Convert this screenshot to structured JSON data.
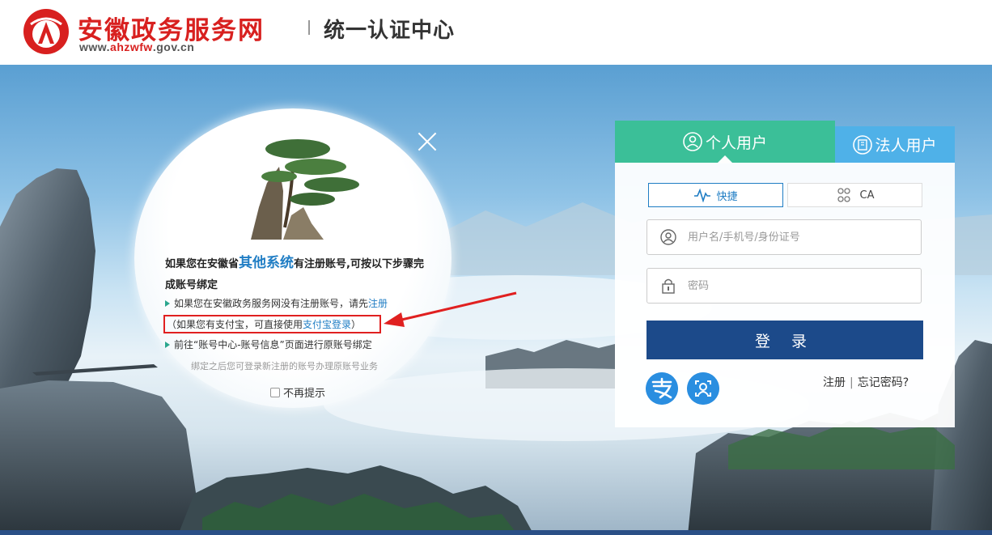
{
  "header": {
    "site_title": "安徽政务服务网",
    "site_url_prefix": "www.",
    "site_url_domain": "ahzwfw",
    "site_url_suffix": ".gov.cn",
    "subtitle": "统一认证中心",
    "brand_color": "#d8201f"
  },
  "popup": {
    "heading_pre": "如果您在安徽省",
    "heading_highlight": "其他系统",
    "heading_post": "有注册账号,可按以下步骤完成账号绑定",
    "step1_text": "如果您在安徽政务服务网没有注册账号，请先",
    "step1_link": "注册",
    "alipay_pre": "（如果您有支付宝，可直接使用",
    "alipay_link": "支付宝登录",
    "alipay_post": "）",
    "step2_text": "前往“账号中心-账号信息”页面进行原账号绑定",
    "note": "绑定之后您可登录新注册的账号办理原账号业务",
    "no_prompt_label": "不再提示",
    "no_prompt_checked": false,
    "close_icon": "close-icon"
  },
  "login": {
    "tab_personal": "个人用户",
    "tab_corporate": "法人用户",
    "mode_fast": "快捷",
    "mode_ca": "CA",
    "username_placeholder": "用户名/手机号/身份证号",
    "password_placeholder": "密码",
    "login_button": "登 录",
    "register_link": "注册",
    "separator": "|",
    "forgot_link": "忘记密码?",
    "colors": {
      "personal_tab": "#3bbf98",
      "corporate_tab": "#4fb1e8",
      "login_button": "#1c4a8a",
      "sso_icon": "#2a8ee0"
    }
  }
}
